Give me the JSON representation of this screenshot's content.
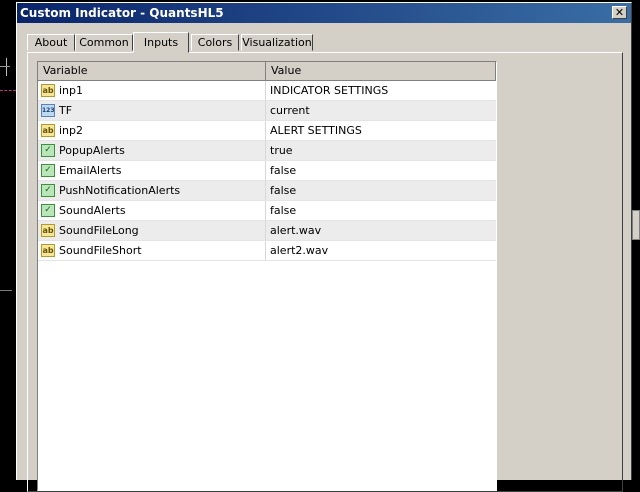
{
  "window": {
    "title": "Custom Indicator - QuantsHL5",
    "close_glyph": "✕"
  },
  "tabs": [
    {
      "label": "About",
      "active": false
    },
    {
      "label": "Common",
      "active": false
    },
    {
      "label": "Inputs",
      "active": true
    },
    {
      "label": "Colors",
      "active": false
    },
    {
      "label": "Visualization",
      "active": false
    }
  ],
  "grid": {
    "headers": {
      "variable": "Variable",
      "value": "Value"
    },
    "rows": [
      {
        "icon": "string-icon",
        "name": "inp1",
        "value": "INDICATOR SETTINGS"
      },
      {
        "icon": "number-icon",
        "name": "TF",
        "value": "current"
      },
      {
        "icon": "string-icon",
        "name": "inp2",
        "value": "ALERT SETTINGS"
      },
      {
        "icon": "boolean-icon",
        "name": "PopupAlerts",
        "value": "true"
      },
      {
        "icon": "boolean-icon",
        "name": "EmailAlerts",
        "value": "false"
      },
      {
        "icon": "boolean-icon",
        "name": "PushNotificationAlerts",
        "value": "false"
      },
      {
        "icon": "boolean-icon",
        "name": "SoundAlerts",
        "value": "false"
      },
      {
        "icon": "string-icon",
        "name": "SoundFileLong",
        "value": "alert.wav"
      },
      {
        "icon": "string-icon",
        "name": "SoundFileShort",
        "value": "alert2.wav"
      }
    ]
  },
  "colors": {
    "titlebar_start": "#0a246a",
    "titlebar_end": "#3a6ea5",
    "dialog_bg": "#d4d0c8"
  }
}
